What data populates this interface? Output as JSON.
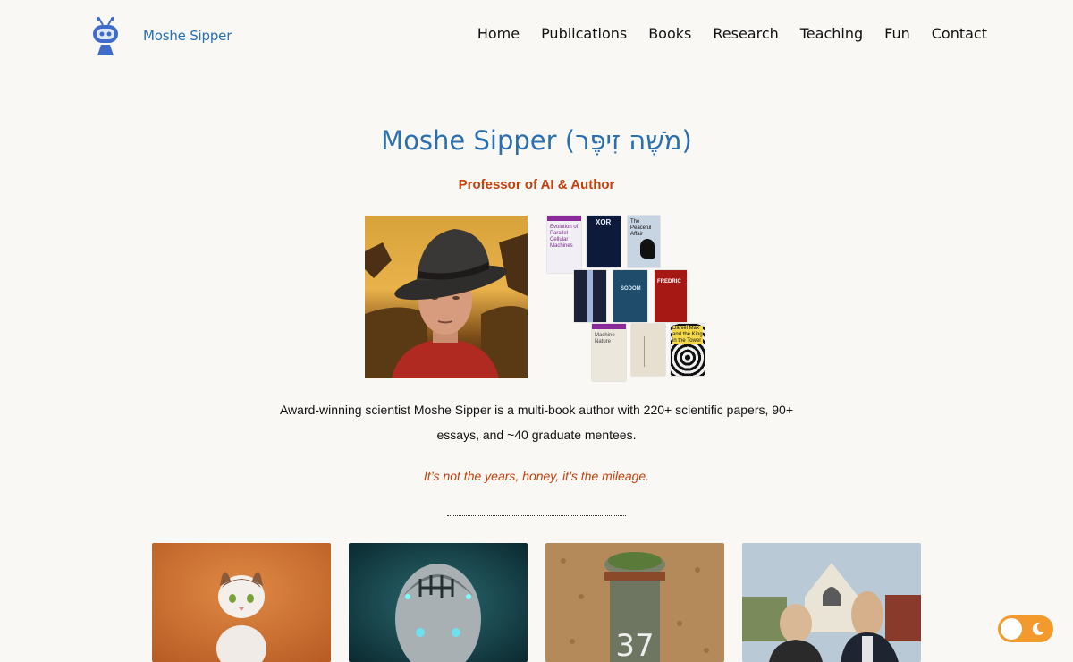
{
  "site": {
    "name": "Moshe Sipper",
    "logo_icon": "robot-icon"
  },
  "nav": {
    "items": [
      "Home",
      "Publications",
      "Books",
      "Research",
      "Teaching",
      "Fun",
      "Contact"
    ]
  },
  "hero": {
    "title": "Moshe Sipper (מֹשֶׁה זִיפֶּר)",
    "subtitle": "Professor of AI & Author",
    "bio": "Award-winning scientist Moshe Sipper is a multi-book author with 220+ scientific papers, 90+ essays, and ~40 graduate mentees.",
    "quote": "It’s not the years, honey, it’s the mileage."
  },
  "books": [
    {
      "title": "Evolution of Parallel Cellular Machines"
    },
    {
      "title": "XOR"
    },
    {
      "title": "The Peaceful Affair"
    },
    {
      "title": ""
    },
    {
      "title": "SODOM"
    },
    {
      "title": "FREDRIC"
    },
    {
      "title": "Machine Nature"
    },
    {
      "title": ""
    },
    {
      "title": "Daniel Max and the King in the Tower"
    }
  ],
  "cards": [
    {
      "name": "cat"
    },
    {
      "name": "ai-face"
    },
    {
      "name": "post-37"
    },
    {
      "name": "american-gothic"
    }
  ],
  "theme_toggle": {
    "icon": "moon-icon",
    "accent": "#f39a2c"
  },
  "colors": {
    "title": "#2a6fb0",
    "accent": "#c4400c",
    "background": "#f9f8f5"
  }
}
